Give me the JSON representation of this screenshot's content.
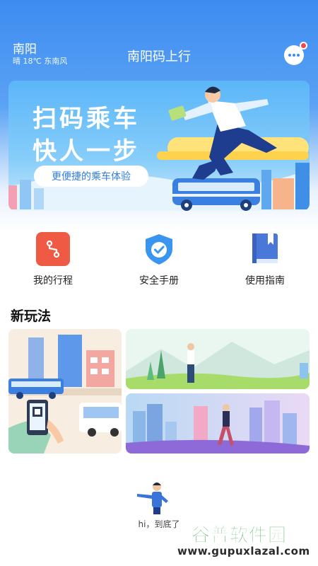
{
  "header": {
    "city": "南阳",
    "weather": "晴 18℃ 东南风",
    "title": "南阳码上行"
  },
  "banner": {
    "line1": "扫码乘车",
    "line2": "快人一步",
    "button": "更便捷的乘车体验"
  },
  "quick_actions": [
    {
      "label": "我的行程",
      "icon": "route-icon"
    },
    {
      "label": "安全手册",
      "icon": "shield-check-icon"
    },
    {
      "label": "使用指南",
      "icon": "book-icon"
    }
  ],
  "section": {
    "title": "新玩法"
  },
  "footer": {
    "end_text": "hi，到底了"
  },
  "watermark": {
    "name": "谷普软件园",
    "url": "www.gupuxlazal.com"
  },
  "colors": {
    "primary": "#3d8cf0",
    "route_icon": "#ee5a44",
    "shield_icon": "#3a95f0",
    "book_icon": "#4a78d8",
    "badge": "#f2454f",
    "watermark": "#2c9f3c"
  }
}
